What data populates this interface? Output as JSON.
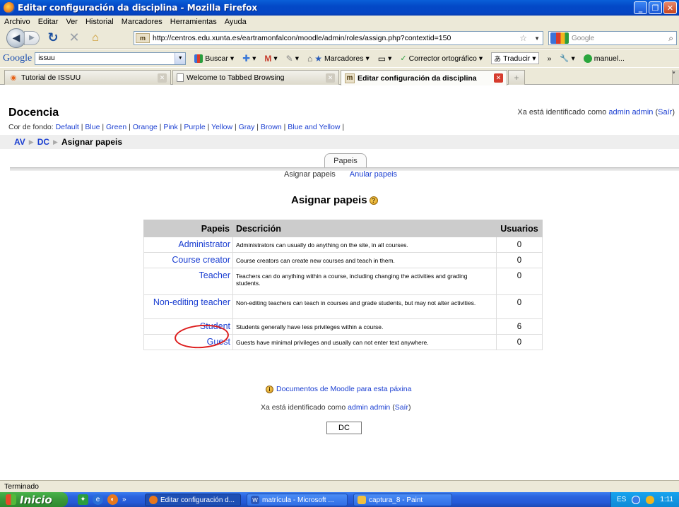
{
  "window": {
    "title": "Editar configuración da disciplina - Mozilla Firefox"
  },
  "menu": [
    "Archivo",
    "Editar",
    "Ver",
    "Historial",
    "Marcadores",
    "Herramientas",
    "Ayuda"
  ],
  "nav": {
    "url": "http://centros.edu.xunta.es/eartramonfalcon/moodle/admin/roles/assign.php?contextid=150",
    "site_icon_text": "m",
    "search_placeholder": "Google"
  },
  "google_toolbar": {
    "logo": "Google",
    "search_value": "issuu",
    "buscar": "Buscar",
    "marcadores": "Marcadores",
    "corrector": "Corrector ortográfico",
    "traducir": "Traducir",
    "user": "manuel..."
  },
  "tabs": [
    {
      "label": "Tutorial de ISSUU",
      "active": false
    },
    {
      "label": "Welcome to Tabbed Browsing",
      "active": false
    },
    {
      "label": "Editar configuración da disciplina",
      "active": true
    }
  ],
  "page": {
    "site_name": "Docencia",
    "login_prefix": "Xa está identificado como ",
    "login_user": "admin admin",
    "login_logout": "Saír",
    "colors_label": "Cor de fondo:",
    "colors": [
      "Default",
      "Blue",
      "Green",
      "Orange",
      "Pink",
      "Purple",
      "Yellow",
      "Gray",
      "Brown",
      "Blue and Yellow"
    ],
    "breadcrumb": [
      "AV",
      "DC",
      "Asignar papeis"
    ],
    "main_tab": "Papeis",
    "subtabs": [
      "Asignar papeis",
      "Anular papeis"
    ],
    "heading": "Asignar papeis",
    "table": {
      "headers": [
        "Papeis",
        "Descrición",
        "Usuarios"
      ],
      "rows": [
        {
          "role": "Administrator",
          "desc": "Administrators can usually do anything on the site, in all courses.",
          "users": "0"
        },
        {
          "role": "Course creator",
          "desc": "Course creators can create new courses and teach in them.",
          "users": "0"
        },
        {
          "role": "Teacher",
          "desc": "Teachers can do anything within a course, including changing the activities and grading students.",
          "users": "0"
        },
        {
          "role": "Non-editing teacher",
          "desc": "Non-editing teachers can teach in courses and grade students, but may not alter activities.",
          "users": "0"
        },
        {
          "role": "Student",
          "desc": "Students generally have less privileges within a course.",
          "users": "6"
        },
        {
          "role": "Guest",
          "desc": "Guests have minimal privileges and usually can not enter text anywhere.",
          "users": "0"
        }
      ]
    },
    "docs_link": "Documentos de Moodle para esta páxina",
    "footer_button": "DC"
  },
  "status": "Terminado",
  "taskbar": {
    "start": "Inicio",
    "tasks": [
      "Editar configuración d...",
      "matrícula - Microsoft ...",
      "captura_8 - Paint"
    ],
    "lang": "ES",
    "clock": "1:11"
  }
}
